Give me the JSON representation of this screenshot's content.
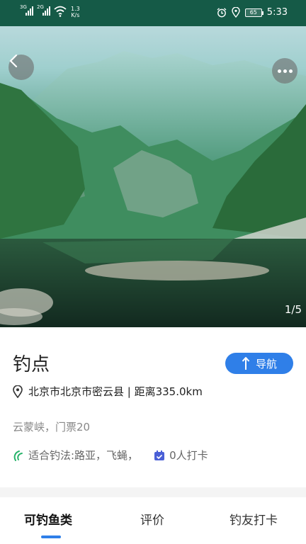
{
  "status_bar": {
    "signal1": "3G",
    "signal2": "2G",
    "speed_value": "1.3",
    "speed_unit": "K/s",
    "battery": "65",
    "time": "5:33"
  },
  "hero": {
    "image_counter": "1/5"
  },
  "spot": {
    "title": "钓点",
    "nav_label": "导航",
    "location": "北京市北京市密云县 | 距离335.0km",
    "description": "云蒙峡，门票20",
    "methods": "适合钓法:路亚，飞蝇，",
    "checkins": "0人打卡"
  },
  "tabs": [
    {
      "label": "可钓鱼类",
      "active": true
    },
    {
      "label": "评价",
      "active": false
    },
    {
      "label": "钓友打卡",
      "active": false
    }
  ],
  "colors": {
    "accent": "#2f7fe8",
    "status_bar": "#155a47",
    "method_icon": "#27b36a",
    "checkin_icon": "#4a5fd6"
  }
}
